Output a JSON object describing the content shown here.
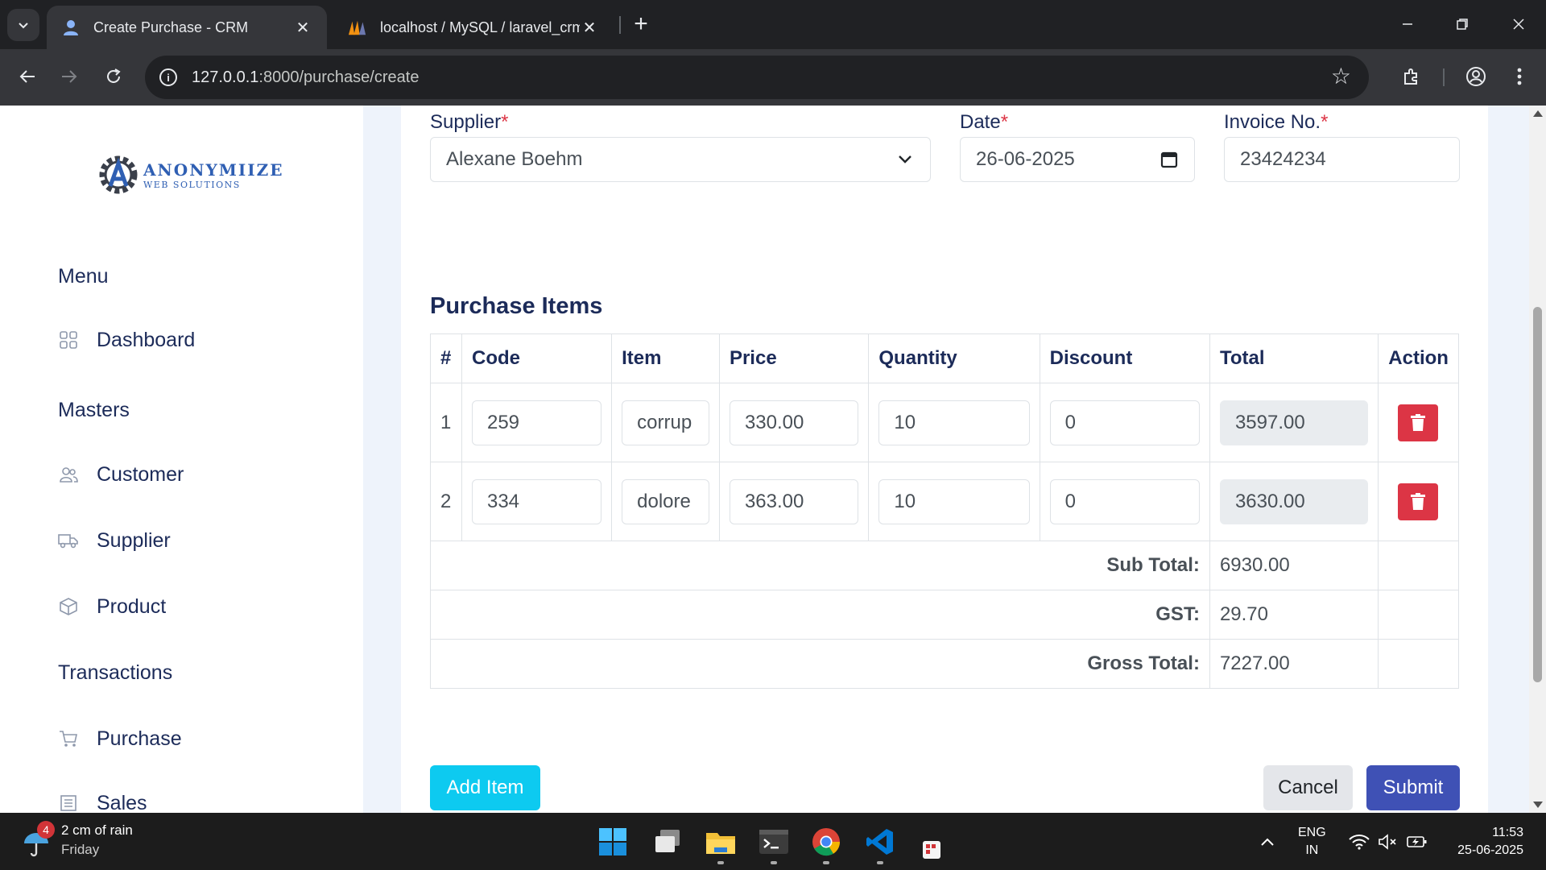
{
  "browser": {
    "tabs": [
      {
        "title": "Create Purchase - CRM",
        "active": true
      },
      {
        "title": "localhost / MySQL / laravel_crm",
        "active": false
      }
    ],
    "url_host": "127.0.0.1",
    "url_rest": ":8000/purchase/create"
  },
  "sidebar": {
    "logo": {
      "brand": "ANONYMIIZE",
      "tagline": "WEB SOLUTIONS"
    },
    "sections": [
      {
        "heading": "Menu",
        "items": [
          {
            "label": "Dashboard",
            "icon": "grid-icon"
          }
        ]
      },
      {
        "heading": "Masters",
        "items": [
          {
            "label": "Customer",
            "icon": "users-icon"
          },
          {
            "label": "Supplier",
            "icon": "truck-icon"
          },
          {
            "label": "Product",
            "icon": "box-icon"
          }
        ]
      },
      {
        "heading": "Transactions",
        "items": [
          {
            "label": "Purchase",
            "icon": "cart-icon"
          },
          {
            "label": "Sales",
            "icon": "receipt-icon"
          }
        ]
      }
    ]
  },
  "form": {
    "supplier": {
      "label": "Supplier",
      "required_mark": "*",
      "value": "Alexane Boehm"
    },
    "date": {
      "label": "Date",
      "required_mark": "*",
      "value": "26-06-2025"
    },
    "invoice": {
      "label": "Invoice No.",
      "required_mark": "*",
      "value": "23424234"
    }
  },
  "items": {
    "title": "Purchase Items",
    "columns": [
      "#",
      "Code",
      "Item",
      "Price",
      "Quantity",
      "Discount",
      "Total",
      "Action"
    ],
    "rows": [
      {
        "n": "1",
        "code": "259",
        "item": "corrup",
        "price": "330.00",
        "qty": "10",
        "discount": "0",
        "total": "3597.00"
      },
      {
        "n": "2",
        "code": "334",
        "item": "dolore",
        "price": "363.00",
        "qty": "10",
        "discount": "0",
        "total": "3630.00"
      }
    ],
    "summary": [
      {
        "label": "Sub Total:",
        "value": "6930.00"
      },
      {
        "label": "GST:",
        "value": "29.70"
      },
      {
        "label": "Gross Total:",
        "value": "7227.00"
      }
    ]
  },
  "buttons": {
    "add": "Add Item",
    "cancel": "Cancel",
    "submit": "Submit"
  },
  "colors": {
    "primary": "#3f51b5",
    "info": "#0dcaf0",
    "danger": "#dc3545",
    "navy": "#1c2b59"
  },
  "taskbar": {
    "weather": {
      "badge": "4",
      "line1": "2 cm of rain",
      "line2": "Friday"
    },
    "lang": {
      "line1": "ENG",
      "line2": "IN"
    },
    "time": "11:53",
    "date": "25-06-2025"
  }
}
